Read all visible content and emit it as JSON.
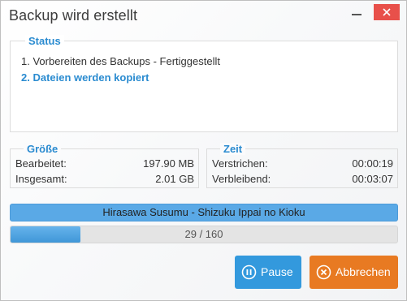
{
  "window": {
    "title": "Backup wird erstellt"
  },
  "status": {
    "legend": "Status",
    "lines": [
      {
        "text": "1. Vorbereiten des Backups - Fertiggestellt"
      },
      {
        "text": "2. Dateien werden kopiert"
      }
    ]
  },
  "size": {
    "legend": "Größe",
    "rows": [
      {
        "label": "Bearbeitet:",
        "value": "197.90 MB"
      },
      {
        "label": "Insgesamt:",
        "value": "2.01 GB"
      }
    ]
  },
  "time": {
    "legend": "Zeit",
    "rows": [
      {
        "label": "Verstrichen:",
        "value": "00:00:19"
      },
      {
        "label": "Verbleibend:",
        "value": "00:03:07"
      }
    ]
  },
  "current_file": "Hirasawa Susumu - Shizuku Ippai no Kioku",
  "progress": {
    "text": "29 / 160",
    "fraction": 0.181
  },
  "buttons": {
    "pause_label": "Pause",
    "cancel_label": "Abbrechen"
  },
  "colors": {
    "accent": "#2a8bd0",
    "pause": "#3399dd",
    "cancel": "#e87a22",
    "close": "#e8504a"
  },
  "icons": {
    "pause": "pause-circle-icon",
    "cancel": "cancel-circle-icon",
    "close": "close-icon",
    "minimize": "minimize-icon"
  }
}
